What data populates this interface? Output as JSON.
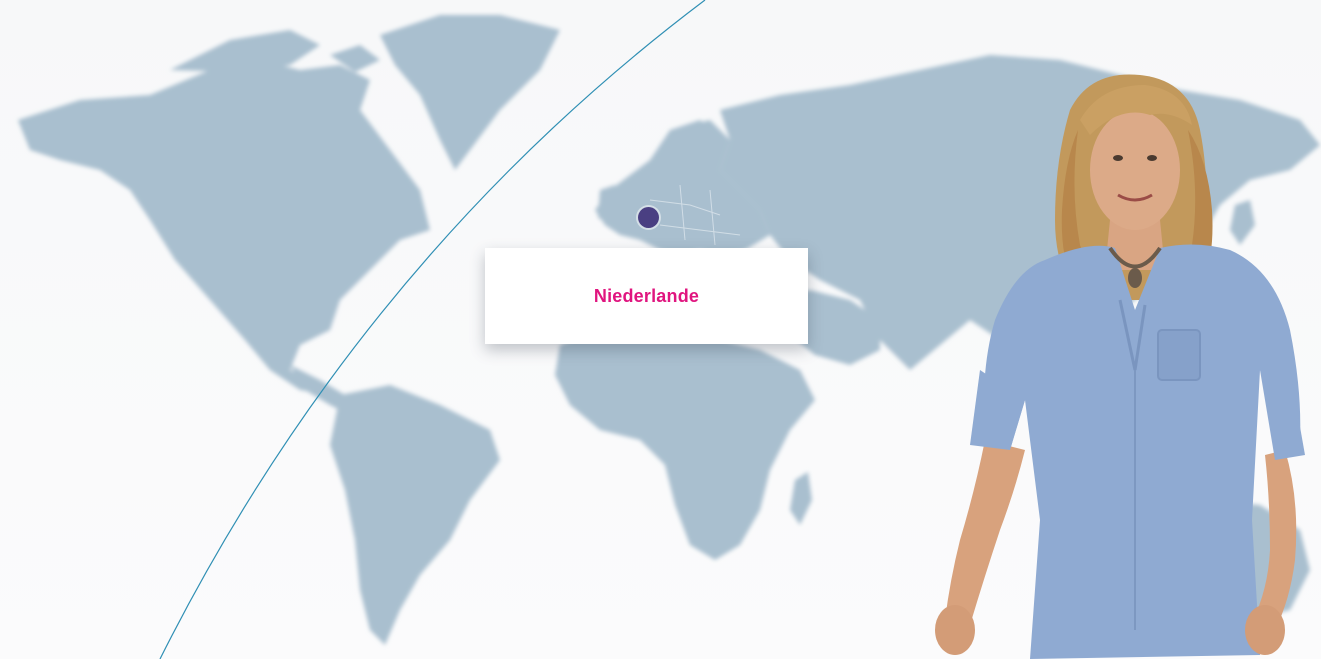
{
  "map": {
    "selected_location": "Niederlande",
    "marker_icon": "location-dot-icon",
    "marker_color": "#4a3f82",
    "land_color": "#a9bfcf",
    "label_color": "#e0157f"
  },
  "person": {
    "icon": "person-photo",
    "shirt_color": "#8faad2",
    "hair_color": "#c2995c"
  }
}
